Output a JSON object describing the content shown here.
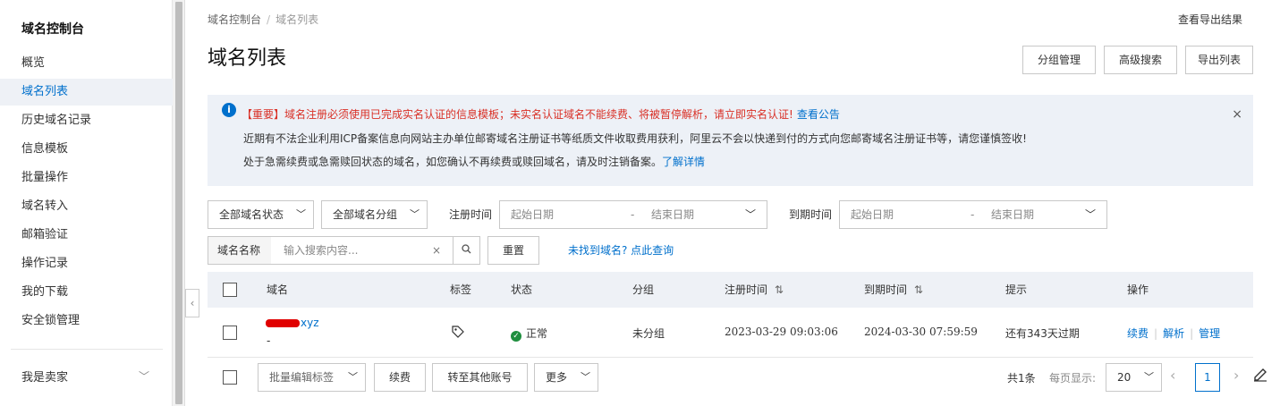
{
  "sidebar": {
    "title": "域名控制台",
    "items": [
      {
        "label": "概览"
      },
      {
        "label": "域名列表"
      },
      {
        "label": "历史域名记录"
      },
      {
        "label": "信息模板"
      },
      {
        "label": "批量操作"
      },
      {
        "label": "域名转入"
      },
      {
        "label": "邮箱验证"
      },
      {
        "label": "操作记录"
      },
      {
        "label": "我的下载"
      },
      {
        "label": "安全锁管理"
      }
    ],
    "seller": "我是卖家"
  },
  "breadcrumb": {
    "root": "域名控制台",
    "sep": "/",
    "current": "域名列表"
  },
  "header": {
    "export_result": "查看导出结果",
    "title": "域名列表",
    "buttons": {
      "group": "分组管理",
      "advanced": "高级搜索",
      "export": "导出列表"
    }
  },
  "notice": {
    "icon": "i",
    "line1": "【重要】域名注册必须使用已完成实名认证的信息模板；未实名认证域名不能续费、将被暂停解析，请立即实名认证!",
    "line1_link": "查看公告",
    "line2": "近期有不法企业利用ICP备案信息向网站主办单位邮寄域名注册证书等纸质文件收取费用获利，阿里云不会以快递到付的方式向您邮寄域名注册证书等，请您谨慎签收!",
    "line3": "处于急需续费或急需赎回状态的域名，如您确认不再续费或赎回域名，请及时注销备案。",
    "line3_link": "了解详情",
    "close": "×"
  },
  "filters": {
    "status": "全部域名状态",
    "group": "全部域名分组",
    "reg_label": "注册时间",
    "exp_label": "到期时间",
    "start_ph": "起始日期",
    "dash": "-",
    "end_ph": "结束日期",
    "search_prefix": "域名名称",
    "search_ph": "输入搜索内容...",
    "clear": "×",
    "reset": "重置",
    "not_found": "未找到域名? 点此查询"
  },
  "table": {
    "headers": {
      "domain": "域名",
      "tag": "标签",
      "status": "状态",
      "group": "分组",
      "reg": "注册时间",
      "exp": "到期时间",
      "hint": "提示",
      "ops": "操作"
    },
    "sort": "⇅",
    "rows": [
      {
        "domain_suffix": "xyz",
        "sub": "-",
        "status": "正常",
        "group": "未分组",
        "reg": "2023-03-29 09:03:06",
        "exp": "2024-03-30 07:59:59",
        "hint": "还有343天过期",
        "op1": "续费",
        "op2": "解析",
        "op3": "管理"
      }
    ]
  },
  "footer": {
    "batch_tag": "批量编辑标签",
    "renew": "续费",
    "transfer": "转至其他账号",
    "more": "更多",
    "total": "共1条",
    "per_page_label": "每页显示:",
    "per_page": "20",
    "page": "1"
  }
}
